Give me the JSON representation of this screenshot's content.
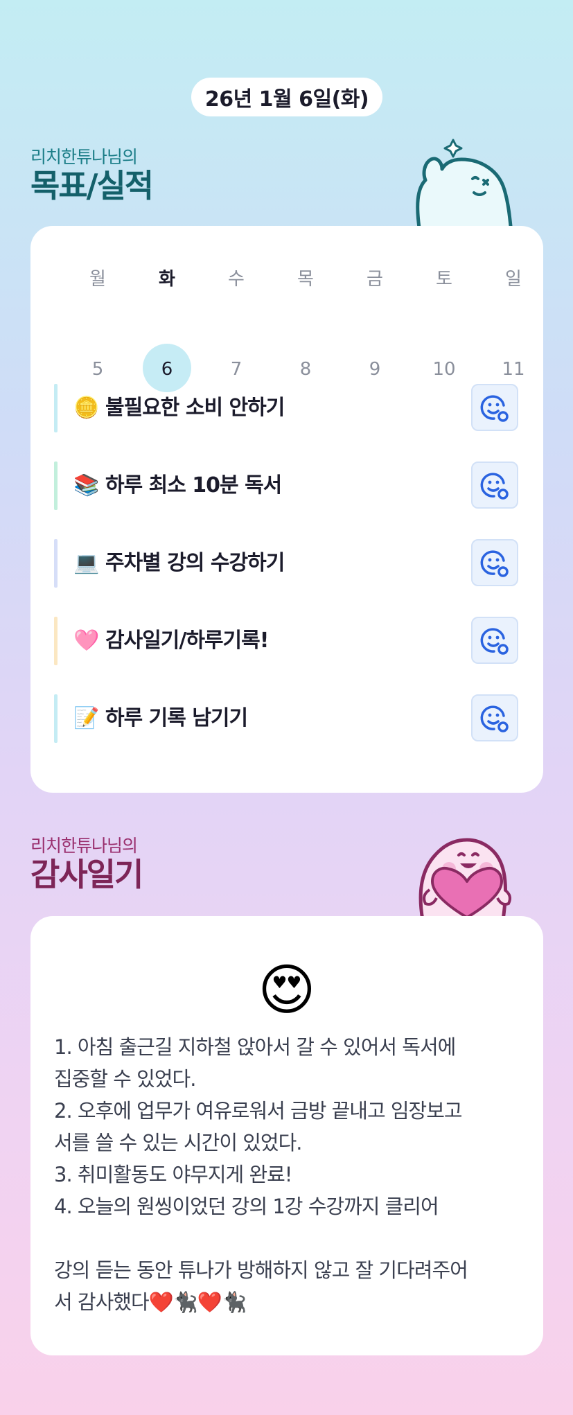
{
  "date": "26년 1월 6일(화)",
  "goals_section": {
    "sub": "리치한튜나님의",
    "title": "목표/실적"
  },
  "week": {
    "days": [
      "월",
      "화",
      "수",
      "목",
      "금",
      "토",
      "일"
    ],
    "dates": [
      "5",
      "6",
      "7",
      "8",
      "9",
      "10",
      "11"
    ],
    "active_index": 1
  },
  "goals": [
    {
      "emoji": "🪙",
      "label": "불필요한 소비 안하기",
      "bar_color": "#c4ecf4",
      "icon": "smile-check-icon"
    },
    {
      "emoji": "📚",
      "label": "하루 최소 10분 독서",
      "bar_color": "#c2efdc",
      "icon": "smile-check-icon"
    },
    {
      "emoji": "💻",
      "label": "주차별 강의 수강하기",
      "bar_color": "#d6def8",
      "icon": "smile-check-icon"
    },
    {
      "emoji": "🩷",
      "label": "감사일기/하루기록!",
      "bar_color": "#fbe7c2",
      "icon": "smile-check-icon"
    },
    {
      "emoji": "📝",
      "label": "하루 기록 남기기",
      "bar_color": "#c4ecf4",
      "icon": "smile-check-icon"
    }
  ],
  "diary_section": {
    "sub": "리치한튜나님의",
    "title": "감사일기"
  },
  "diary": {
    "emoji": "😍",
    "lines": [
      "1. 아침 출근길 지하철 앉아서 갈 수 있어서 독서에",
      "집중할 수 있었다.",
      "2. 오후에 업무가 여유로워서 금방 끝내고 임장보고",
      "서를 쓸 수 있는 시간이 있었다.",
      "3. 취미활동도 야무지게 완료!",
      "4. 오늘의 원씽이었던 강의 1강 수강까지 클리어",
      "",
      "강의 듣는 동안 튜나가 방해하지 않고 잘 기다려주어",
      "서 감사했다❤️🐈‍⬛❤️🐈‍⬛"
    ]
  },
  "colors": {
    "accent_teal": "#14606a",
    "accent_plum": "#7d2557",
    "check_icon": "#2a63e0"
  }
}
